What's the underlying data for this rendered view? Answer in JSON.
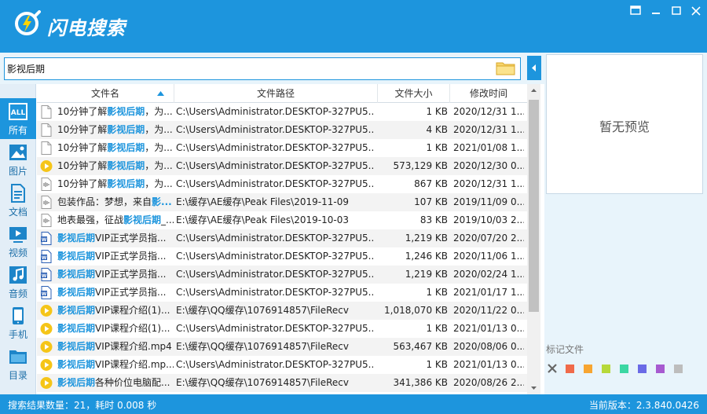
{
  "app": {
    "title": "闪电搜索"
  },
  "search": {
    "value": "影视后期"
  },
  "sidebar": {
    "items": [
      {
        "label": "所有",
        "icon": "all-icon"
      },
      {
        "label": "图片",
        "icon": "image-icon"
      },
      {
        "label": "文档",
        "icon": "document-icon"
      },
      {
        "label": "视频",
        "icon": "video-icon"
      },
      {
        "label": "音频",
        "icon": "audio-icon"
      },
      {
        "label": "手机",
        "icon": "phone-icon"
      },
      {
        "label": "目录",
        "icon": "folder-icon"
      }
    ]
  },
  "table": {
    "headers": {
      "name": "文件名",
      "path": "文件路径",
      "size": "文件大小",
      "date": "修改时间"
    },
    "rows": [
      {
        "icon": "file",
        "pre": "10分钟了解",
        "hl": "影视后期",
        "post": "，为...",
        "path": "C:\\Users\\Administrator.DESKTOP-327PU5...",
        "size": "1 KB",
        "date": "2020/12/31 1..."
      },
      {
        "icon": "file",
        "pre": "10分钟了解",
        "hl": "影视后期",
        "post": "，为...",
        "path": "C:\\Users\\Administrator.DESKTOP-327PU5...",
        "size": "4 KB",
        "date": "2020/12/31 1..."
      },
      {
        "icon": "file",
        "pre": "10分钟了解",
        "hl": "影视后期",
        "post": "，为...",
        "path": "C:\\Users\\Administrator.DESKTOP-327PU5...",
        "size": "1 KB",
        "date": "2021/01/08 1..."
      },
      {
        "icon": "video",
        "pre": "10分钟了解",
        "hl": "影视后期",
        "post": "，为...",
        "path": "C:\\Users\\Administrator.DESKTOP-327PU5...",
        "size": "573,129 KB",
        "date": "2020/12/30 0..."
      },
      {
        "icon": "audio",
        "pre": "10分钟了解",
        "hl": "影视后期",
        "post": "，为...",
        "path": "C:\\Users\\Administrator.DESKTOP-327PU5...",
        "size": "867 KB",
        "date": "2020/12/31 1..."
      },
      {
        "icon": "audio",
        "pre": "包装作品：梦想，来自",
        "hl": "影...",
        "post": "",
        "path": "E:\\缓存\\AE缓存\\Peak Files\\2019-11-09",
        "size": "107 KB",
        "date": "2019/11/09 0..."
      },
      {
        "icon": "audio",
        "pre": "地表最强，征战",
        "hl": "影视后期",
        "post": "_...",
        "path": "E:\\缓存\\AE缓存\\Peak Files\\2019-10-03",
        "size": "83 KB",
        "date": "2019/10/03 2..."
      },
      {
        "icon": "word",
        "pre": "",
        "hl": "影视后期",
        "post": "VIP正式学员指...",
        "path": "C:\\Users\\Administrator.DESKTOP-327PU5...",
        "size": "1,219 KB",
        "date": "2020/07/20 2..."
      },
      {
        "icon": "word",
        "pre": "",
        "hl": "影视后期",
        "post": "VIP正式学员指...",
        "path": "C:\\Users\\Administrator.DESKTOP-327PU5...",
        "size": "1,246 KB",
        "date": "2020/11/06 1..."
      },
      {
        "icon": "word",
        "pre": "",
        "hl": "影视后期",
        "post": "VIP正式学员指...",
        "path": "C:\\Users\\Administrator.DESKTOP-327PU5...",
        "size": "1,219 KB",
        "date": "2020/02/24 1..."
      },
      {
        "icon": "word",
        "pre": "",
        "hl": "影视后期",
        "post": "VIP正式学员指...",
        "path": "C:\\Users\\Administrator.DESKTOP-327PU5...",
        "size": "1 KB",
        "date": "2021/01/17 1..."
      },
      {
        "icon": "video",
        "pre": "",
        "hl": "影视后期",
        "post": "VIP课程介绍(1)...",
        "path": "E:\\缓存\\QQ缓存\\1076914857\\FileRecv",
        "size": "1,018,070 KB",
        "date": "2020/11/22 0..."
      },
      {
        "icon": "video",
        "pre": "",
        "hl": "影视后期",
        "post": "VIP课程介绍(1)...",
        "path": "C:\\Users\\Administrator.DESKTOP-327PU5...",
        "size": "1 KB",
        "date": "2021/01/13 0..."
      },
      {
        "icon": "video",
        "pre": "",
        "hl": "影视后期",
        "post": "VIP课程介绍.mp4",
        "path": "E:\\缓存\\QQ缓存\\1076914857\\FileRecv",
        "size": "563,467 KB",
        "date": "2020/08/06 0..."
      },
      {
        "icon": "video",
        "pre": "",
        "hl": "影视后期",
        "post": "VIP课程介绍.mp...",
        "path": "C:\\Users\\Administrator.DESKTOP-327PU5...",
        "size": "1 KB",
        "date": "2021/01/13 0..."
      },
      {
        "icon": "video",
        "pre": "",
        "hl": "影视后期",
        "post": "各种价位电脑配...",
        "path": "E:\\缓存\\QQ缓存\\1076914857\\FileRecv",
        "size": "341,386 KB",
        "date": "2020/08/26 2..."
      }
    ]
  },
  "preview": {
    "empty_text": "暂无预览"
  },
  "marks": {
    "label": "标记文件",
    "colors": [
      "#f06a4a",
      "#f7a531",
      "#b6d93a",
      "#3bd7a3",
      "#6a6ae6",
      "#a75ad0",
      "#bdbdbd"
    ]
  },
  "status": {
    "left": "搜索结果数量：21，耗时 0.008 秒",
    "right": "当前版本：2.3.840.0426"
  },
  "colors": {
    "accent": "#1d95dd",
    "highlight": "#1d95dd",
    "video_icon": "#f5c518"
  }
}
